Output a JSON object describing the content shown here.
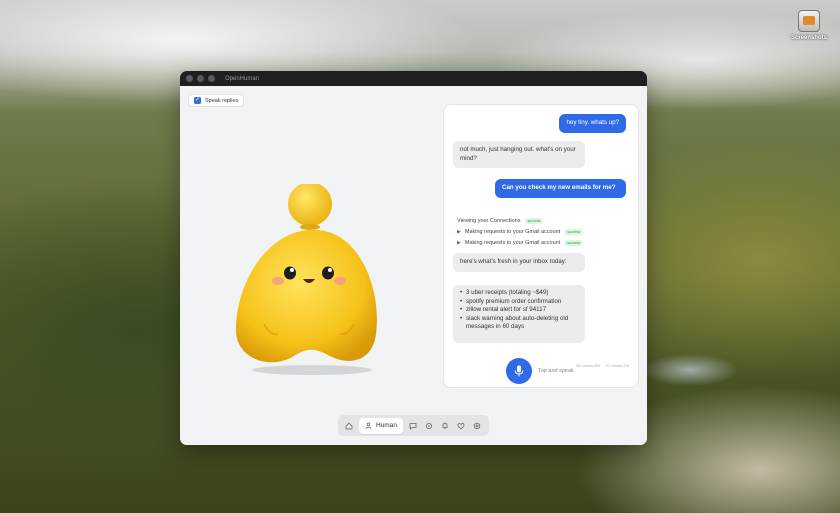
{
  "window": {
    "title": "OpenHuman"
  },
  "desktop": {
    "icon_label": "Screenshots"
  },
  "speak_toggle": {
    "label": "Speak replies",
    "checked": true
  },
  "chat": {
    "messages": [
      {
        "role": "user",
        "text": "hey tiny. whats up?"
      },
      {
        "role": "assistant",
        "text": "not much, just hanging out. what's on your mind?"
      },
      {
        "role": "user",
        "text": "Can you check my new emails for me?"
      }
    ],
    "tool_calls": {
      "header": "Viewing your Connections",
      "header_status": "success",
      "items": [
        {
          "label": "Making requests to your Gmail account",
          "status": "success"
        },
        {
          "label": "Making requests to your Gmail account",
          "status": "success"
        }
      ]
    },
    "reply_intro": "here's what's fresh in your inbox today:",
    "reply_items": [
      "3 uber receipts (totaling ~$49)",
      "spotify premium order confirmation",
      "zillow rental alert for sf 94117",
      "slack warning about auto-deleting old messages in 60 days"
    ],
    "stats": [
      "94 voices 8%",
      "70 voices 0%"
    ],
    "tap_label": "Tap and speak"
  },
  "nav": {
    "active_label": "Human",
    "icons": [
      "home-icon",
      "person-icon",
      "chat-icon",
      "skills-icon",
      "bell-icon",
      "heart-icon",
      "settings-icon"
    ]
  },
  "colors": {
    "accent": "#2f6be6",
    "mascot": "#f5c518",
    "titlebar": "#1f1f1f"
  }
}
